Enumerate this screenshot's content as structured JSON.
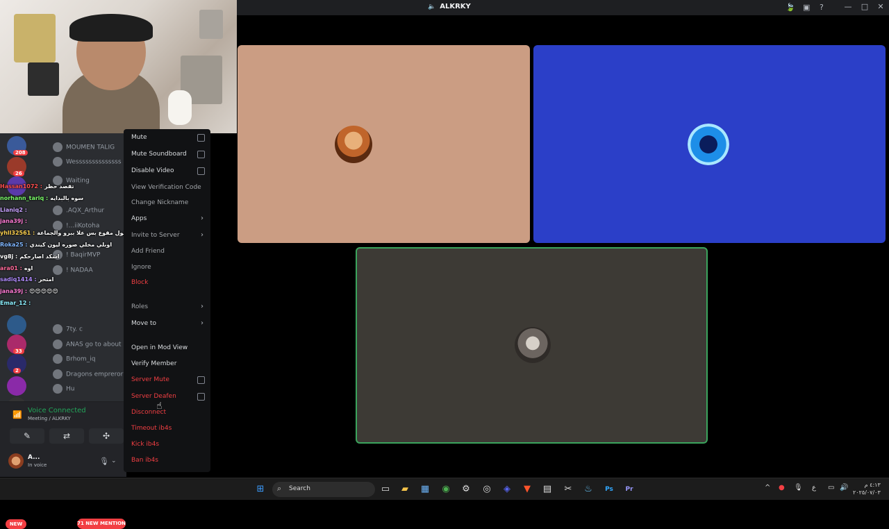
{
  "window": {
    "title": "ALKRKY",
    "title_prefix_icon": "speaker-icon"
  },
  "colors": {
    "discord_bg": "#2b2d31",
    "menu_bg": "#111214",
    "danger": "#f23f43",
    "voice_green": "#23a55a",
    "tile1": "#cb9d83",
    "tile2": "#2b3fc8",
    "tile3": "#3d3a35"
  },
  "servers": [
    {
      "badge": "208"
    },
    {
      "badge": "26"
    },
    {
      "badge": ""
    },
    {
      "badge": ""
    },
    {
      "badge": "33"
    },
    {
      "badge": "2"
    },
    {
      "badge": ""
    },
    {
      "badge": ""
    }
  ],
  "members": [
    {
      "name": "MOUMEN TALIG"
    },
    {
      "name": "Wessssssssssssss"
    },
    {
      "name": "Waiting"
    },
    {
      "name": ".AQX_Arthur"
    },
    {
      "name": "!...iiKotoha"
    },
    {
      "name": "! BaqirMVP"
    },
    {
      "name": "! NADAA"
    },
    {
      "name": "7ty. c"
    },
    {
      "name": "ANAS go to about n"
    },
    {
      "name": "Brhom_iq"
    },
    {
      "name": "Dragons emprerorr"
    },
    {
      "name": "Hu"
    }
  ],
  "chat": [
    {
      "user": "Hassan1072 :",
      "text": "تقصد حظر",
      "color": "#ff4f4f"
    },
    {
      "user": "norhann_tariq :",
      "text": "سوه بالبدايه",
      "color": "#7cff6b"
    },
    {
      "user": "Lianiq2 :",
      "text": "",
      "color": "#c8a2ff"
    },
    {
      "user": "jana39j :",
      "text": "",
      "color": "#ff7bd5"
    },
    {
      "user": "yhll32561 :",
      "text": "يكول مقوع بس علا ببرو والجماعة",
      "color": "#ffd24f"
    },
    {
      "user": "Roka25 :",
      "text": "اوبلي مخلي صوره ليون كيندي",
      "color": "#7fb6ff"
    },
    {
      "user": "vg8j :",
      "text": "اشكد اصارحكم",
      "color": "#ffffff"
    },
    {
      "user": "ara01 :",
      "text": "اوه",
      "color": "#ff6b9a"
    },
    {
      "user": "sadiq1414 :",
      "text": "امتحر",
      "color": "#b18cff"
    },
    {
      "user": "jana39j :",
      "text": "😍😍😍😍😍",
      "color": "#ff7bd5"
    },
    {
      "user": "Emar_12 :",
      "text": "",
      "color": "#8cf0ff"
    }
  ],
  "pills": {
    "new": "NEW",
    "mentions": "71 NEW MENTION"
  },
  "voice": {
    "status": "Voice Connected",
    "channel": "Meeting / ALKRKY",
    "user_name": "A...",
    "user_status": "In voice"
  },
  "context_menu": {
    "items": [
      {
        "label": "Mute",
        "type": "check",
        "style": "normal",
        "name": "menu-mute"
      },
      {
        "label": "Mute Soundboard",
        "type": "check",
        "style": "normal",
        "name": "menu-mute-soundboard"
      },
      {
        "label": "Disable Video",
        "type": "check",
        "style": "normal",
        "name": "menu-disable-video"
      },
      {
        "label": "View Verification Code",
        "type": "plain",
        "style": "dim",
        "name": "menu-view-verification-code"
      },
      {
        "label": "Change Nickname",
        "type": "plain",
        "style": "dim",
        "name": "menu-change-nickname"
      },
      {
        "label": "Apps",
        "type": "submenu",
        "style": "normal",
        "name": "menu-apps"
      },
      {
        "label": "Invite to Server",
        "type": "submenu",
        "style": "dim",
        "name": "menu-invite-to-server"
      },
      {
        "label": "Add Friend",
        "type": "plain",
        "style": "dim",
        "name": "menu-add-friend"
      },
      {
        "label": "Ignore",
        "type": "plain",
        "style": "dim",
        "name": "menu-ignore"
      },
      {
        "label": "Block",
        "type": "plain",
        "style": "red",
        "name": "menu-block"
      },
      {
        "label": "Roles",
        "type": "submenu",
        "style": "dim",
        "name": "menu-roles"
      },
      {
        "label": "Move to",
        "type": "submenu",
        "style": "normal",
        "name": "menu-move-to"
      },
      {
        "label": "Open in Mod View",
        "type": "plain",
        "style": "normal",
        "name": "menu-open-mod-view"
      },
      {
        "label": "Verify Member",
        "type": "plain",
        "style": "normal",
        "name": "menu-verify-member"
      },
      {
        "label": "Server Mute",
        "type": "check",
        "style": "red",
        "name": "menu-server-mute"
      },
      {
        "label": "Server Deafen",
        "type": "check",
        "style": "red",
        "name": "menu-server-deafen"
      },
      {
        "label": "Disconnect",
        "type": "plain",
        "style": "red",
        "name": "menu-disconnect"
      },
      {
        "label": "Timeout ib4s",
        "type": "plain",
        "style": "red",
        "name": "menu-timeout"
      },
      {
        "label": "Kick ib4s",
        "type": "plain",
        "style": "red",
        "name": "menu-kick"
      },
      {
        "label": "Ban ib4s",
        "type": "plain",
        "style": "red",
        "name": "menu-ban"
      }
    ]
  },
  "taskbar": {
    "search_label": "Search",
    "clock_time": "٤:١٣ م",
    "clock_date": "٢٠٢٥/٠٧/٠٣"
  }
}
